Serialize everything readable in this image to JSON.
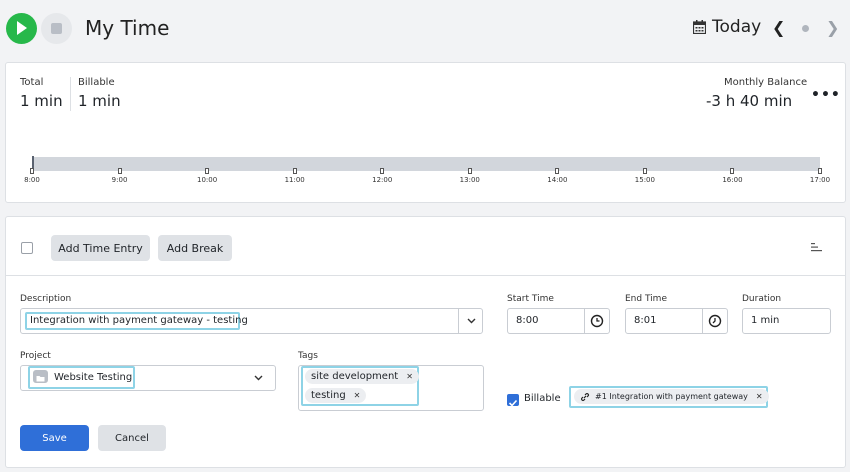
{
  "header": {
    "title": "My Time",
    "date_label": "Today",
    "play_icon": "play-icon",
    "stop_icon": "stop-icon",
    "calendar_icon": "calendar-icon",
    "accent_color": "#27b84a"
  },
  "summary": {
    "total_label": "Total",
    "total_value": "1 min",
    "billable_label": "Billable",
    "billable_value": "1 min",
    "monthly_balance_label": "Monthly Balance",
    "monthly_balance_value": "-3 h 40 min",
    "more_label": "•••",
    "timeline_ticks": [
      "8:00",
      "9:00",
      "10:00",
      "11:00",
      "12:00",
      "13:00",
      "14:00",
      "15:00",
      "16:00",
      "17:00"
    ]
  },
  "toolbar": {
    "add_time_entry": "Add Time Entry",
    "add_break": "Add Break"
  },
  "form": {
    "description_label": "Description",
    "description_value": "Integration with payment gateway - testing",
    "start_label": "Start Time",
    "start_value": "8:00",
    "end_label": "End Time",
    "end_value": "8:01",
    "duration_label": "Duration",
    "duration_value": "1 min",
    "project_label": "Project",
    "project_value": "Website Testing",
    "tags_label": "Tags",
    "tags": [
      "site development",
      "testing"
    ],
    "billable_label": "Billable",
    "billable_checked": true,
    "linked_issue": "#1 Integration with payment gateway",
    "save_label": "Save",
    "cancel_label": "Cancel",
    "primary_color": "#2f6fd8"
  }
}
